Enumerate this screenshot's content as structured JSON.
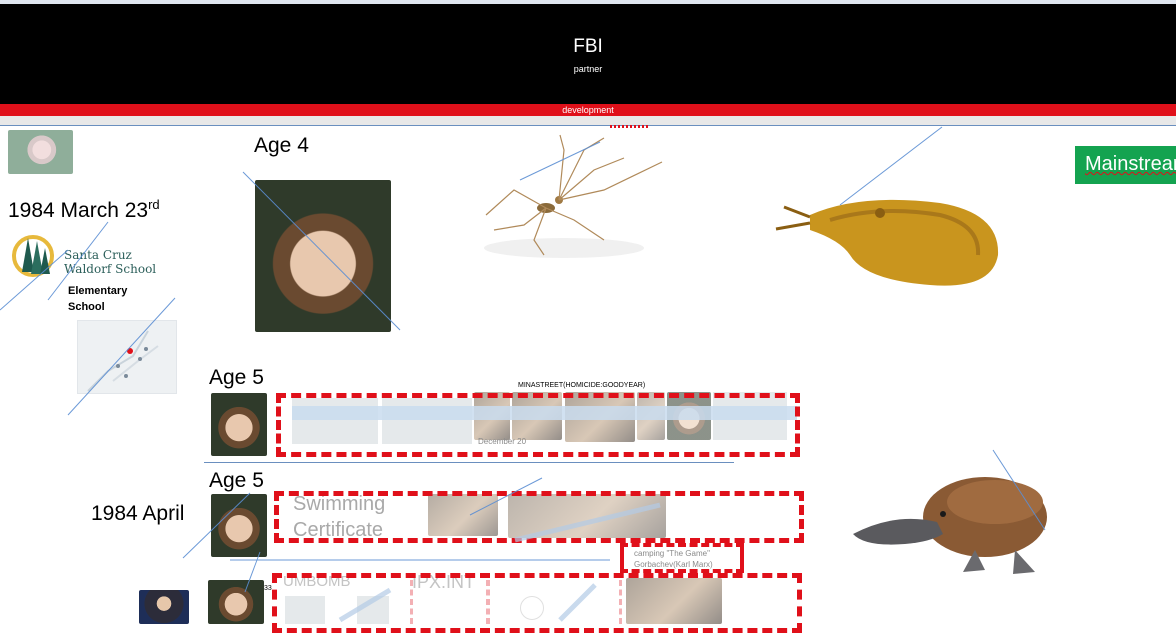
{
  "header": {
    "title": "FBI",
    "subtitle": "partner",
    "bar_label": "development"
  },
  "sidebar": {
    "date_main": "1984 March 23",
    "date_sup": "rd",
    "school_logo_line1": "Santa Cruz",
    "school_logo_line2": "Waldorf School",
    "school_type_line1": "Elementary",
    "school_type_line2": "School",
    "date_april": "1984 April"
  },
  "timeline": {
    "age4_label": "Age 4",
    "age5a_label": "Age 5",
    "age5b_label": "Age 5",
    "mina_label": "MINASTREET(HOMICIDE:GOODYEAR)",
    "strip_caption": "December 20",
    "swim_line1": "Swimming",
    "swim_line2": "Certificate",
    "camping_line1": "camping   \"The Game\"",
    "camping_line2": "Gorbachev(Karl Marx)",
    "bottom_ghost_left": "UMBOMB",
    "bottom_ghost_right": "IPX.INT",
    "bottom_num": "33"
  },
  "action": {
    "mainstream_label": "Mainstream"
  },
  "colors": {
    "accent_red": "#e0101a",
    "banner_black": "#000000",
    "mainstream_green": "#14a350",
    "connector_blue": "#6a8fbf"
  }
}
